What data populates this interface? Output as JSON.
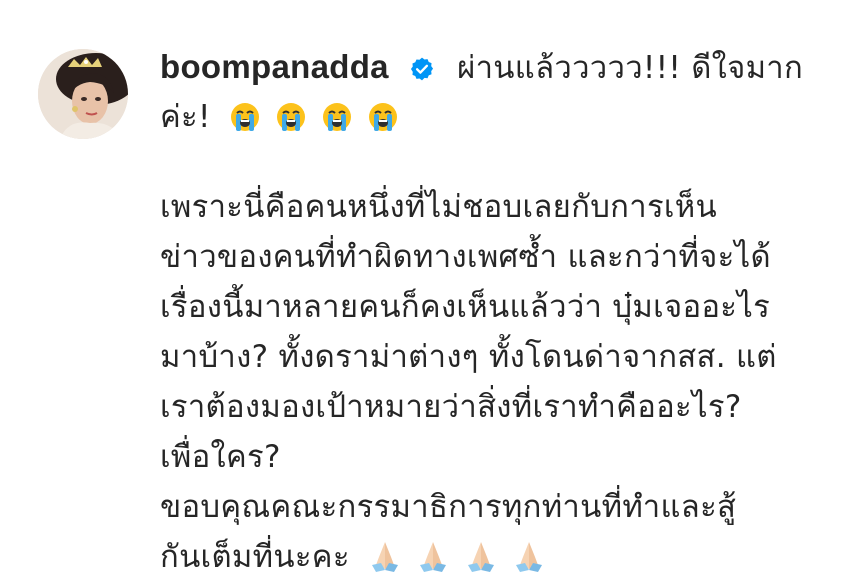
{
  "comment": {
    "username": "boompanadda",
    "verified": true,
    "lines": [
      "ผ่านแล้ววววว!!! ดีใจมาก",
      "ค่ะ!",
      "เพราะนี่คือคนหนึ่งที่ไม่ชอบเลยกับการเห็น",
      "ข่าวของคนที่ทำผิดทางเพศซ้ำ และกว่าที่จะได้",
      "เรื่องนี้มาหลายคนก็คงเห็นแล้วว่า บุ๋มเจออะไร",
      "มาบ้าง? ทั้งดราม่าต่างๆ ทั้งโดนด่าจากสส. แต่",
      "เราต้องมองเป้าหมายว่าสิ่งที่เราทำคืออะไร?",
      "เพื่อใคร?",
      "ขอบคุณคณะกรรมาธิการทุกท่านที่ทำและสู้",
      "กันเต็มที่นะคะ"
    ],
    "emoji_cry_count": 4,
    "emoji_pray_count": 4
  },
  "icons": {
    "verified": "verified-badge-icon",
    "cry": "loudly-crying-face-emoji",
    "pray": "folded-hands-emoji"
  },
  "colors": {
    "text": "#262626",
    "verified_blue": "#0095f6"
  }
}
